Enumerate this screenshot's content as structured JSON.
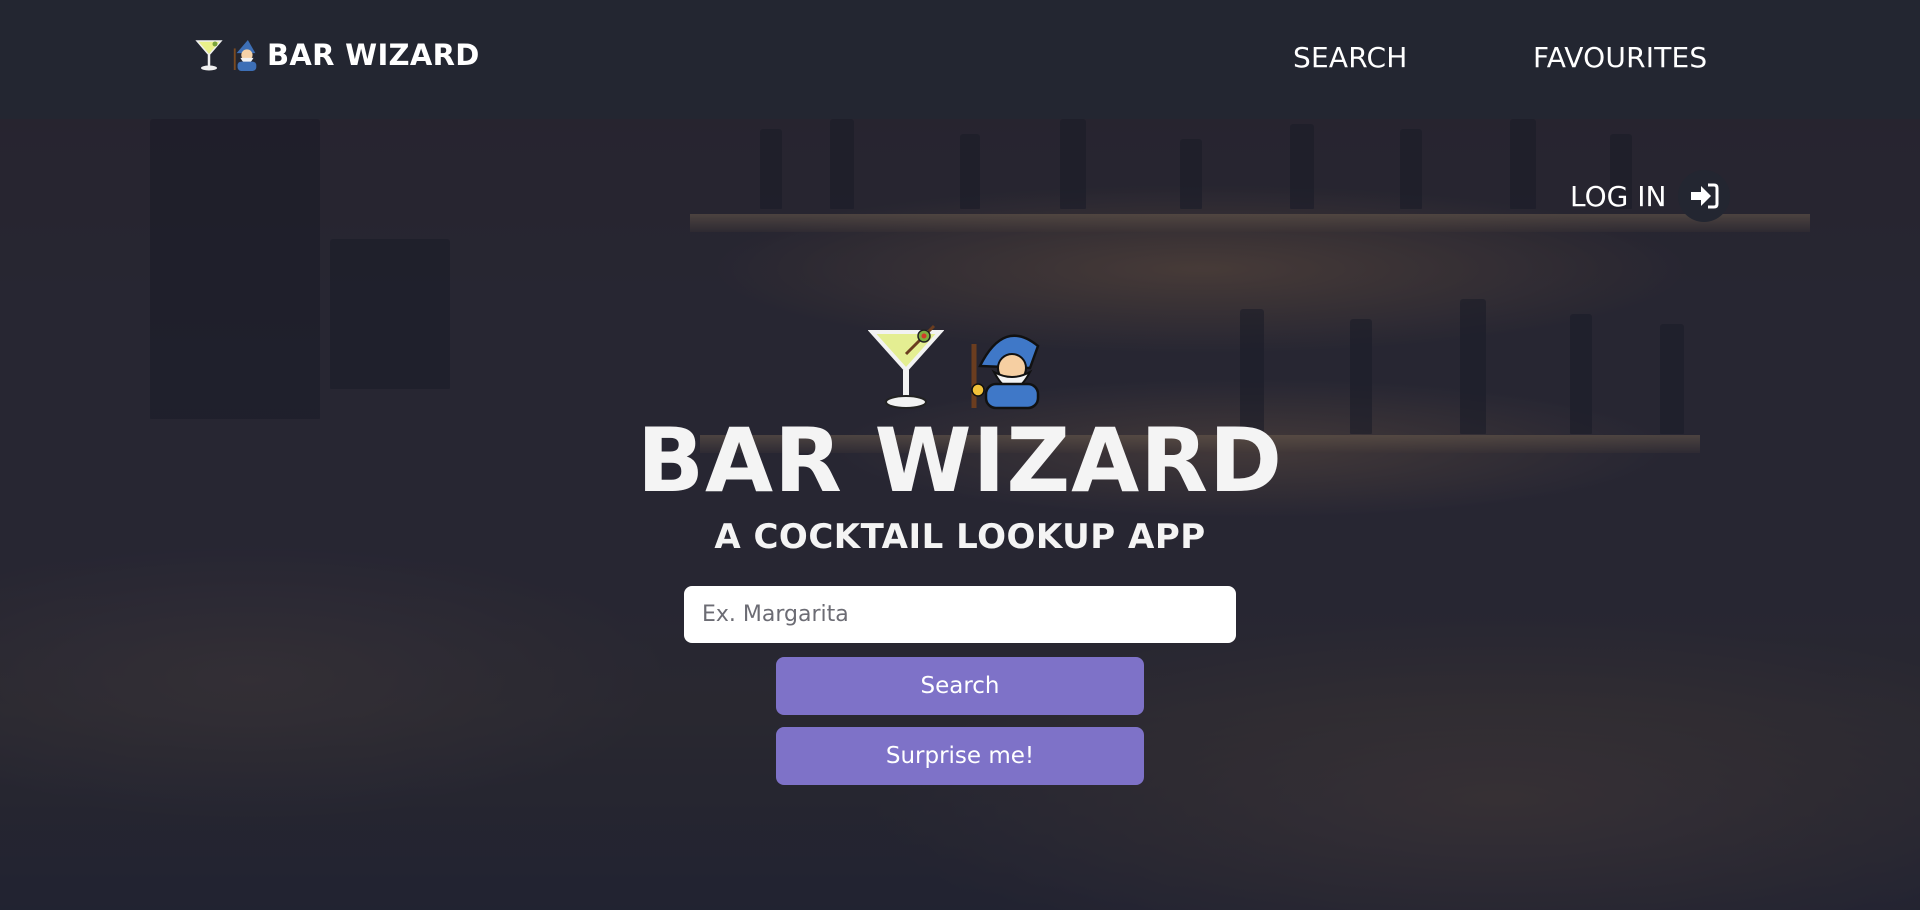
{
  "navbar": {
    "brand_text": "BAR WIZARD",
    "links": [
      {
        "label": "SEARCH"
      },
      {
        "label": "FAVOURITES"
      }
    ]
  },
  "hero": {
    "login_label": "LOG IN",
    "title": "BAR WIZARD",
    "subtitle": "A COCKTAIL LOOKUP APP",
    "search_placeholder": "Ex. Margarita",
    "search_value": "",
    "search_button": "Search",
    "surprise_button": "Surprise me!"
  },
  "icons": {
    "brand": [
      "cocktail-glass-icon",
      "wizard-icon"
    ],
    "login": "sign-in-icon"
  },
  "colors": {
    "navbar_bg": "#232631",
    "button_bg": "#7e72c8",
    "text": "#ffffff"
  }
}
